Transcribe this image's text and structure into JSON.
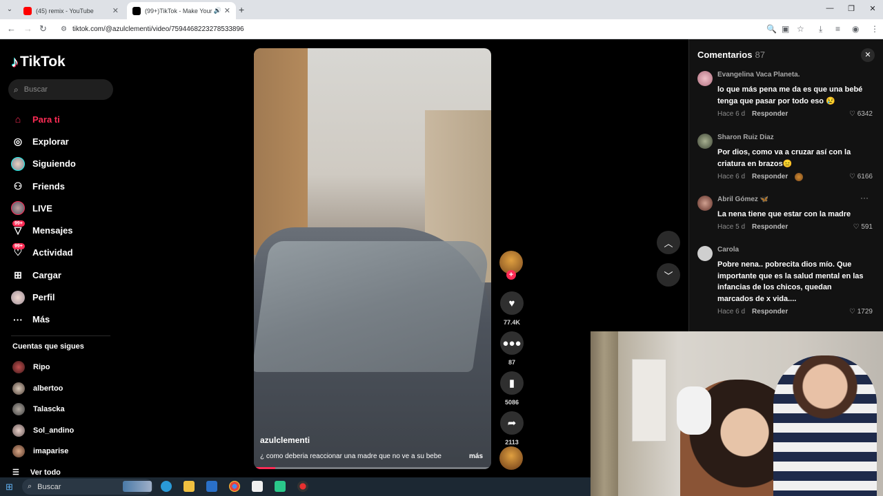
{
  "browser": {
    "tabs": [
      {
        "title": "(45) remix - YouTube",
        "favicon_color": "#ff0000"
      },
      {
        "title": "(99+)TikTok - Make Your Da",
        "favicon_color": "#000000"
      }
    ],
    "url": "tiktok.com/@azulclementi/video/7594468223278533896"
  },
  "tiktok": {
    "logo": "TikTok",
    "search_placeholder": "Buscar",
    "nav": [
      {
        "label": "Para ti",
        "icon": "home-icon"
      },
      {
        "label": "Explorar",
        "icon": "compass-icon"
      },
      {
        "label": "Siguiendo",
        "icon": "following-avatar-icon"
      },
      {
        "label": "Friends",
        "icon": "friends-icon"
      },
      {
        "label": "LIVE",
        "icon": "live-avatar-icon"
      },
      {
        "label": "Mensajes",
        "icon": "messages-icon",
        "badge": "99+"
      },
      {
        "label": "Actividad",
        "icon": "activity-icon",
        "badge": "99+"
      },
      {
        "label": "Cargar",
        "icon": "upload-icon"
      },
      {
        "label": "Perfil",
        "icon": "profile-avatar-icon"
      },
      {
        "label": "Más",
        "icon": "more-icon"
      }
    ],
    "following_title": "Cuentas que sigues",
    "following": [
      "Ripo",
      "albertoo",
      "Talascka",
      "Sol_andino",
      "imaparise"
    ],
    "see_all": "Ver todo",
    "video": {
      "author": "azulclementi",
      "description": "¿ como deberia reaccionar una madre que no ve a su bebe",
      "more": "más",
      "progress": 0.09
    },
    "actions": {
      "likes": "77.4K",
      "comments": "87",
      "saves": "5086",
      "shares": "2113"
    },
    "comments_panel": {
      "title": "Comentarios",
      "count": "87",
      "reply_label": "Responder",
      "items": [
        {
          "user": "Evangelina Vaca Planeta.",
          "text": "lo que más pena me da es que una bebé tenga que pasar por todo eso 😢",
          "time": "Hace 6 d",
          "likes": "6342"
        },
        {
          "user": "Sharon Ruiz Diaz",
          "text": "Por dios, como va a cruzar así con la criatura en brazos😑",
          "time": "Hace 6 d",
          "likes": "6166"
        },
        {
          "user": "Abril Gómez 🦋",
          "text": "La nena tiene que estar con la madre",
          "time": "Hace 5 d",
          "likes": "591"
        },
        {
          "user": "Carola",
          "text": "Pobre nena.. pobrecita dios mío. Que importante que es la salud mental en las infancias de los chicos, quedan marcados de x vida....",
          "time": "Hace 6 d",
          "likes": "1729"
        }
      ]
    }
  },
  "taskbar": {
    "search_placeholder": "Buscar"
  },
  "colors": {
    "accent": "#fe2c55",
    "background": "#000000",
    "panel": "#121212"
  }
}
